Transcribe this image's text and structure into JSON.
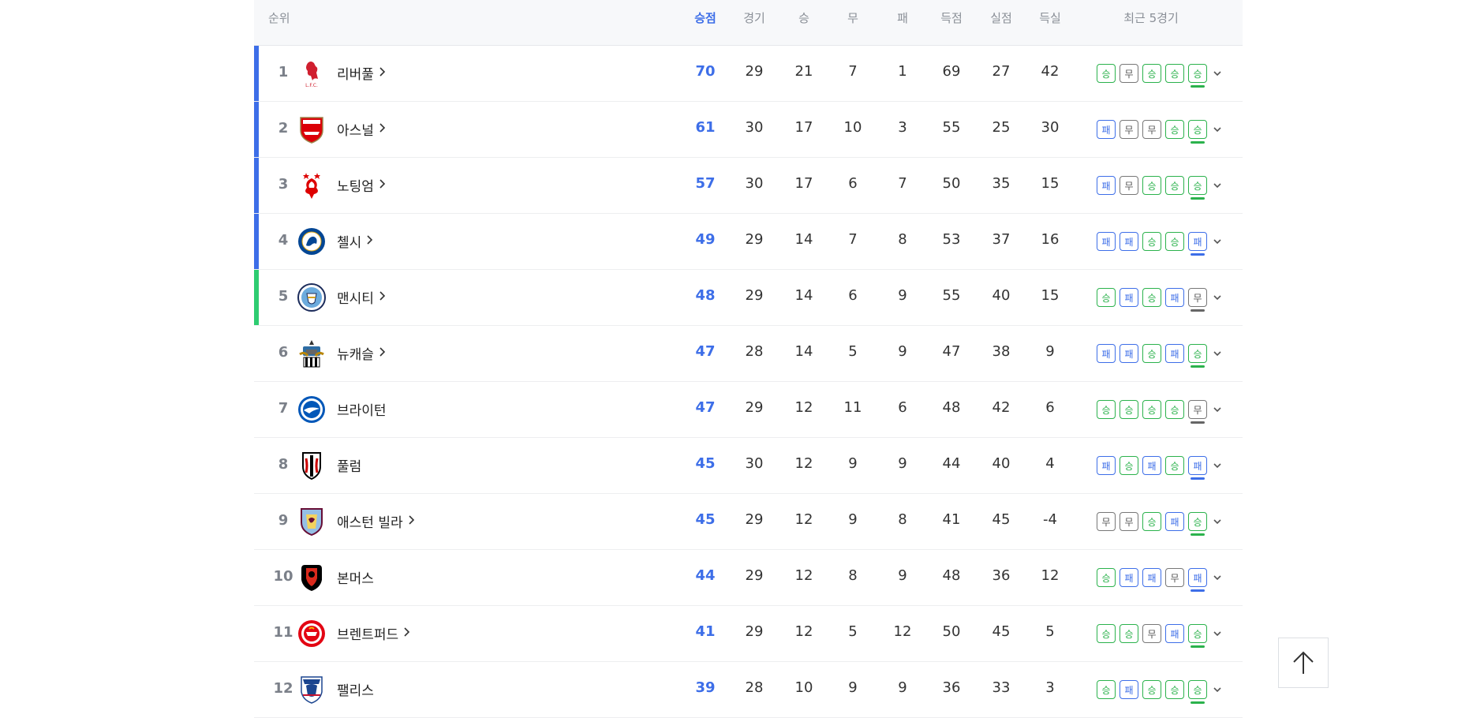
{
  "header": {
    "rank": "순위",
    "points": "승점",
    "played": "경기",
    "won": "승",
    "drawn": "무",
    "lost": "패",
    "goals_for": "득점",
    "goals_against": "실점",
    "goal_diff": "득실",
    "recent_form": "최근 5경기"
  },
  "colors": {
    "accent": "#3d6ee8",
    "win": "#2bb24c",
    "loss": "#3d6ee8",
    "draw": "#777777",
    "champions_league_bar": "#3d6ee8",
    "europa_bar": "#2ecc71"
  },
  "result_labels": {
    "W": "승",
    "D": "무",
    "L": "패"
  },
  "rows": [
    {
      "rank": "1",
      "team": "리버풀",
      "link": true,
      "zone": "ucl",
      "logo": "liverpool-crest-icon",
      "pts": "70",
      "p": "29",
      "w": "21",
      "d": "7",
      "l": "1",
      "gf": "69",
      "ga": "27",
      "gd": "42",
      "form": [
        "W",
        "D",
        "W",
        "W",
        "W"
      ]
    },
    {
      "rank": "2",
      "team": "아스널",
      "link": true,
      "zone": "ucl",
      "logo": "arsenal-crest-icon",
      "pts": "61",
      "p": "30",
      "w": "17",
      "d": "10",
      "l": "3",
      "gf": "55",
      "ga": "25",
      "gd": "30",
      "form": [
        "L",
        "D",
        "D",
        "W",
        "W"
      ]
    },
    {
      "rank": "3",
      "team": "노팅엄",
      "link": true,
      "zone": "ucl",
      "logo": "nottingham-crest-icon",
      "pts": "57",
      "p": "30",
      "w": "17",
      "d": "6",
      "l": "7",
      "gf": "50",
      "ga": "35",
      "gd": "15",
      "form": [
        "L",
        "D",
        "W",
        "W",
        "W"
      ]
    },
    {
      "rank": "4",
      "team": "첼시",
      "link": true,
      "zone": "ucl",
      "logo": "chelsea-crest-icon",
      "pts": "49",
      "p": "29",
      "w": "14",
      "d": "7",
      "l": "8",
      "gf": "53",
      "ga": "37",
      "gd": "16",
      "form": [
        "L",
        "L",
        "W",
        "W",
        "L"
      ]
    },
    {
      "rank": "5",
      "team": "맨시티",
      "link": true,
      "zone": "uel",
      "logo": "mancity-crest-icon",
      "pts": "48",
      "p": "29",
      "w": "14",
      "d": "6",
      "l": "9",
      "gf": "55",
      "ga": "40",
      "gd": "15",
      "form": [
        "W",
        "L",
        "W",
        "L",
        "D"
      ]
    },
    {
      "rank": "6",
      "team": "뉴캐슬",
      "link": true,
      "zone": "",
      "logo": "newcastle-crest-icon",
      "pts": "47",
      "p": "28",
      "w": "14",
      "d": "5",
      "l": "9",
      "gf": "47",
      "ga": "38",
      "gd": "9",
      "form": [
        "L",
        "L",
        "W",
        "L",
        "W"
      ]
    },
    {
      "rank": "7",
      "team": "브라이턴",
      "link": false,
      "zone": "",
      "logo": "brighton-crest-icon",
      "pts": "47",
      "p": "29",
      "w": "12",
      "d": "11",
      "l": "6",
      "gf": "48",
      "ga": "42",
      "gd": "6",
      "form": [
        "W",
        "W",
        "W",
        "W",
        "D"
      ]
    },
    {
      "rank": "8",
      "team": "풀럼",
      "link": false,
      "zone": "",
      "logo": "fulham-crest-icon",
      "pts": "45",
      "p": "30",
      "w": "12",
      "d": "9",
      "l": "9",
      "gf": "44",
      "ga": "40",
      "gd": "4",
      "form": [
        "L",
        "W",
        "L",
        "W",
        "L"
      ]
    },
    {
      "rank": "9",
      "team": "애스턴 빌라",
      "link": true,
      "zone": "",
      "logo": "astonvilla-crest-icon",
      "pts": "45",
      "p": "29",
      "w": "12",
      "d": "9",
      "l": "8",
      "gf": "41",
      "ga": "45",
      "gd": "-4",
      "form": [
        "D",
        "D",
        "W",
        "L",
        "W"
      ]
    },
    {
      "rank": "10",
      "team": "본머스",
      "link": false,
      "zone": "",
      "logo": "bournemouth-crest-icon",
      "pts": "44",
      "p": "29",
      "w": "12",
      "d": "8",
      "l": "9",
      "gf": "48",
      "ga": "36",
      "gd": "12",
      "form": [
        "W",
        "L",
        "L",
        "D",
        "L"
      ]
    },
    {
      "rank": "11",
      "team": "브렌트퍼드",
      "link": true,
      "zone": "",
      "logo": "brentford-crest-icon",
      "pts": "41",
      "p": "29",
      "w": "12",
      "d": "5",
      "l": "12",
      "gf": "50",
      "ga": "45",
      "gd": "5",
      "form": [
        "W",
        "W",
        "D",
        "L",
        "W"
      ]
    },
    {
      "rank": "12",
      "team": "팰리스",
      "link": false,
      "zone": "",
      "logo": "palace-crest-icon",
      "pts": "39",
      "p": "28",
      "w": "10",
      "d": "9",
      "l": "9",
      "gf": "36",
      "ga": "33",
      "gd": "3",
      "form": [
        "W",
        "L",
        "W",
        "W",
        "W"
      ]
    }
  ],
  "scroll_top_icon": "arrow-up-icon"
}
